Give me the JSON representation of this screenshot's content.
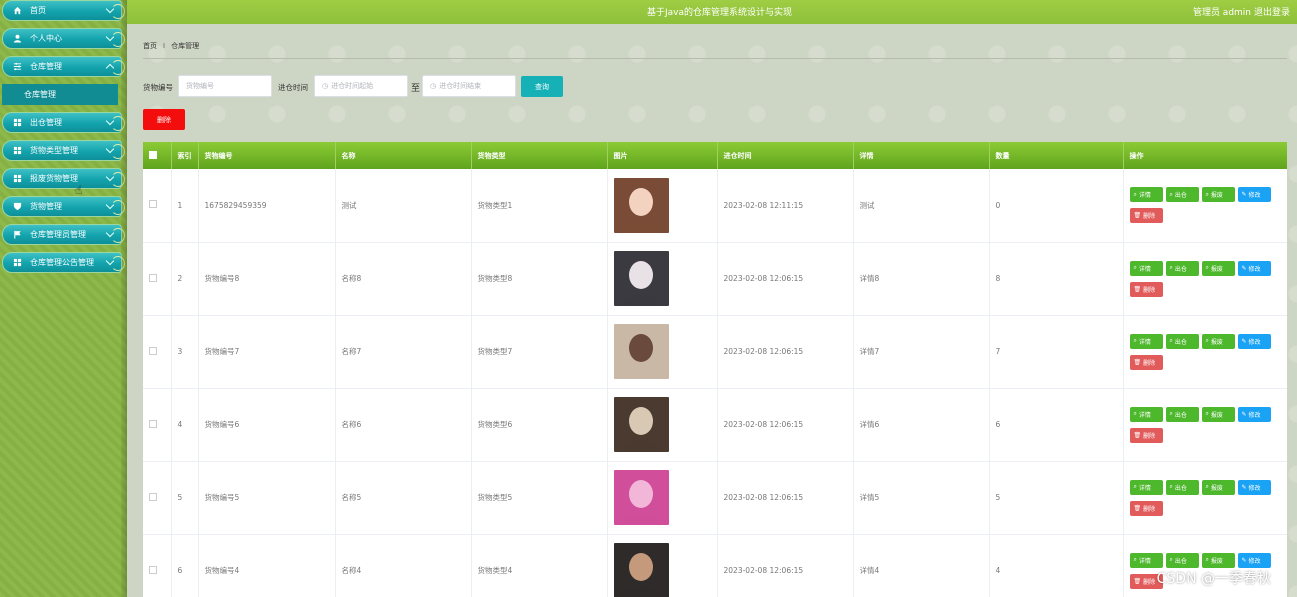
{
  "header": {
    "app_title": "基于Java的仓库管理系统设计与实现",
    "user_info": "管理员 admin",
    "logout_label": "退出登录"
  },
  "sidebar": {
    "items": [
      {
        "label": "首页",
        "icon": "home-icon"
      },
      {
        "label": "个人中心",
        "icon": "user-icon"
      },
      {
        "label": "仓库管理",
        "icon": "sliders-icon",
        "expanded": true
      },
      {
        "label": "出仓管理",
        "icon": "grid-icon"
      },
      {
        "label": "货物类型管理",
        "icon": "grid-icon"
      },
      {
        "label": "报废货物管理",
        "icon": "grid-icon"
      },
      {
        "label": "货物管理",
        "icon": "shield-icon"
      },
      {
        "label": "仓库管理员管理",
        "icon": "flag-icon"
      },
      {
        "label": "仓库管理公告管理",
        "icon": "grid-icon"
      }
    ],
    "sub_item": "仓库管理"
  },
  "breadcrumb": {
    "home": "首页",
    "separator": "I",
    "current": "仓库管理"
  },
  "search": {
    "code_label": "货物编号",
    "code_placeholder": "货物编号",
    "time_label": "进仓时间",
    "start_placeholder": "进仓时间起始",
    "to_label": "至",
    "end_placeholder": "进仓时间结束",
    "search_button": "查询"
  },
  "delete_button": "删除",
  "table": {
    "columns": [
      "索引",
      "货物编号",
      "名称",
      "货物类型",
      "图片",
      "进仓时间",
      "详情",
      "数量",
      "操作"
    ],
    "actions": {
      "detail": "详情",
      "out": "出仓",
      "scrap": "报废",
      "edit": "修改",
      "delete": "删除"
    },
    "rows": [
      {
        "index": "1",
        "code": "1675829459359",
        "name": "测试",
        "type": "货物类型1",
        "time": "2023-02-08 12:11:15",
        "detail": "测试",
        "qty": "0"
      },
      {
        "index": "2",
        "code": "货物编号8",
        "name": "名称8",
        "type": "货物类型8",
        "time": "2023-02-08 12:06:15",
        "detail": "详情8",
        "qty": "8"
      },
      {
        "index": "3",
        "code": "货物编号7",
        "name": "名称7",
        "type": "货物类型7",
        "time": "2023-02-08 12:06:15",
        "detail": "详情7",
        "qty": "7"
      },
      {
        "index": "4",
        "code": "货物编号6",
        "name": "名称6",
        "type": "货物类型6",
        "time": "2023-02-08 12:06:15",
        "detail": "详情6",
        "qty": "6"
      },
      {
        "index": "5",
        "code": "货物编号5",
        "name": "名称5",
        "type": "货物类型5",
        "time": "2023-02-08 12:06:15",
        "detail": "详情5",
        "qty": "5"
      },
      {
        "index": "6",
        "code": "货物编号4",
        "name": "名称4",
        "type": "货物类型4",
        "time": "2023-02-08 12:06:15",
        "detail": "详情4",
        "qty": "4"
      }
    ]
  },
  "watermark": "CSDN @一季春秋",
  "colors": {
    "accent": "#16b0b7",
    "header_green": "#8ec03a",
    "danger": "#f40d0d"
  }
}
